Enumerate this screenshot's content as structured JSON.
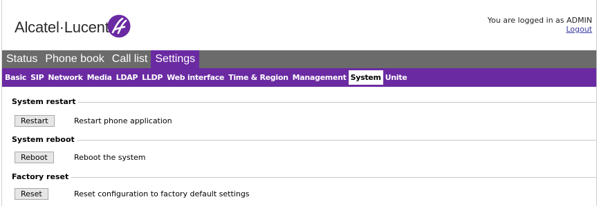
{
  "brand": {
    "name": "Alcatel·Lucent"
  },
  "login": {
    "text": "You are logged in as ADMIN",
    "logout_label": "Logout"
  },
  "main_nav": [
    {
      "label": "Status",
      "active": false
    },
    {
      "label": "Phone book",
      "active": false
    },
    {
      "label": "Call list",
      "active": false
    },
    {
      "label": "Settings",
      "active": true
    }
  ],
  "sub_nav": [
    {
      "label": "Basic",
      "active": false
    },
    {
      "label": "SIP",
      "active": false
    },
    {
      "label": "Network",
      "active": false
    },
    {
      "label": "Media",
      "active": false
    },
    {
      "label": "LDAP",
      "active": false
    },
    {
      "label": "LLDP",
      "active": false
    },
    {
      "label": "Web interface",
      "active": false
    },
    {
      "label": "Time & Region",
      "active": false
    },
    {
      "label": "Management",
      "active": false
    },
    {
      "label": "System",
      "active": true
    },
    {
      "label": "Unite",
      "active": false
    }
  ],
  "sections": {
    "restart": {
      "title": "System restart",
      "button": "Restart",
      "description": "Restart phone application"
    },
    "reboot": {
      "title": "System reboot",
      "button": "Reboot",
      "description": "Reboot the system"
    },
    "factory": {
      "title": "Factory reset",
      "button": "Reset",
      "description": "Reset configuration to factory default settings"
    }
  },
  "colors": {
    "purple": "#6a2aa2",
    "gray_nav": "#6b6b6b"
  }
}
